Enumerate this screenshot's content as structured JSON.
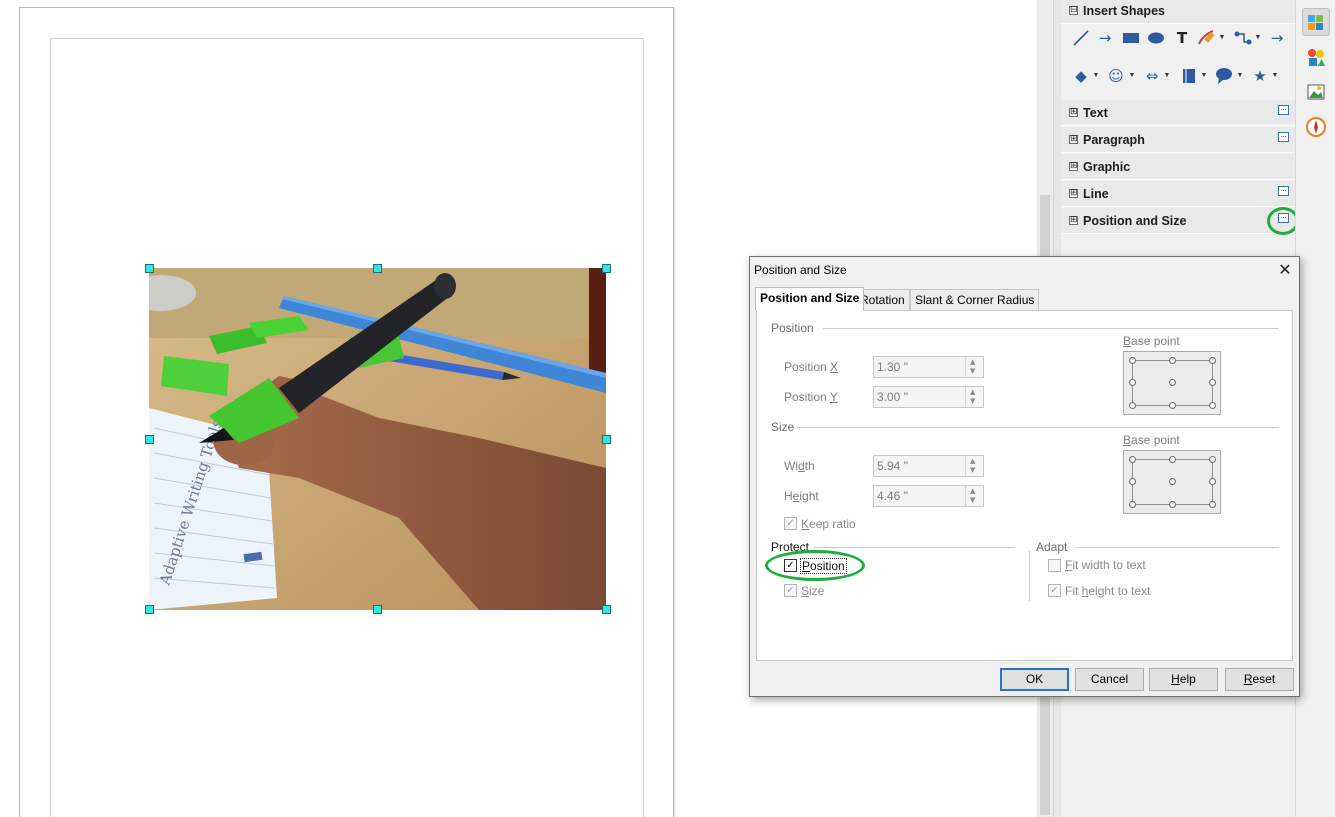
{
  "sidebar": {
    "insert_shapes": {
      "label": "Insert Shapes",
      "expander": "⊟"
    },
    "sections": [
      {
        "label": "Text",
        "expander": "⊞",
        "has_more": true
      },
      {
        "label": "Paragraph",
        "expander": "⊞",
        "has_more": true
      },
      {
        "label": "Graphic",
        "expander": "⊞",
        "has_more": false
      },
      {
        "label": "Line",
        "expander": "⊞",
        "has_more": true
      },
      {
        "label": "Position and Size",
        "expander": "⊞",
        "has_more": true
      }
    ],
    "tools_row1": [
      "line-tool-icon",
      "arrow-line-icon",
      "rectangle-icon",
      "ellipse-icon",
      "text-tool-icon",
      "freeform-pen-icon",
      "connector-icon",
      "arrow-shapes-icon"
    ],
    "tools_row2": [
      "basic-shapes-icon",
      "smiley-symbol-icon",
      "block-arrows-icon",
      "flowchart-icon",
      "callout-icon",
      "star-icon"
    ]
  },
  "tool_glyphs": {
    "text": "T",
    "arrow": "→",
    "diamond": "◆",
    "smiley": "☺",
    "double_arrow": "⇔",
    "callout": "💬",
    "star": "★",
    "dropdown": "▼"
  },
  "deck": [
    "properties-deck-icon",
    "styles-deck-icon",
    "gallery-deck-icon",
    "navigator-deck-icon"
  ],
  "dialog": {
    "title": "Position and Size",
    "close_glyph": "✕",
    "tabs": [
      "Position and Size",
      "Rotation",
      "Slant & Corner Radius"
    ],
    "position": {
      "heading": "Position",
      "x_label_pre": "Position ",
      "x_label_key": "X",
      "x_value": "1.30 \"",
      "y_label_pre": "Position ",
      "y_label_key": "Y",
      "y_value": "3.00 \"",
      "base_point_label_key": "B",
      "base_point_label_rest": "ase point"
    },
    "size": {
      "heading": "Size",
      "width_pre": "Wi",
      "width_key": "d",
      "width_post": "th",
      "width_value": "5.94 \"",
      "height_pre": "H",
      "height_key": "e",
      "height_post": "ight",
      "height_value": "4.46 \"",
      "base_point_label_key": "B",
      "base_point_label_rest": "ase point",
      "keep_ratio_key": "K",
      "keep_ratio_rest": "eep ratio",
      "keep_ratio_checked": true
    },
    "protect": {
      "heading": "Protect",
      "position_key": "P",
      "position_rest": "osition",
      "position_checked": true,
      "size_key": "S",
      "size_rest": "ize",
      "size_checked": true
    },
    "adapt": {
      "heading": "Adapt",
      "fit_width_key": "F",
      "fit_width_rest": "it width to text",
      "fit_width_checked": false,
      "fit_height_pre": "Fit ",
      "fit_height_key": "h",
      "fit_height_rest": "eight to text",
      "fit_height_checked": true
    },
    "buttons": {
      "ok": "OK",
      "cancel": "Cancel",
      "help_key": "H",
      "help_rest": "elp",
      "reset_key": "R",
      "reset_rest": "eset"
    },
    "spin_up": "▲",
    "spin_down": "▼",
    "check_glyph": "✓"
  },
  "document": {
    "image_alt": "Photo of a hand holding a pen with a green adaptive grip writing on a notepad",
    "notepad_text": "Adaptive Writing Tools"
  },
  "colors": {
    "handle": "#33e6e6",
    "highlight_ring": "#1fae3c",
    "icon_blue": "#2b5aa0",
    "default_button": "#2a6fd1"
  }
}
